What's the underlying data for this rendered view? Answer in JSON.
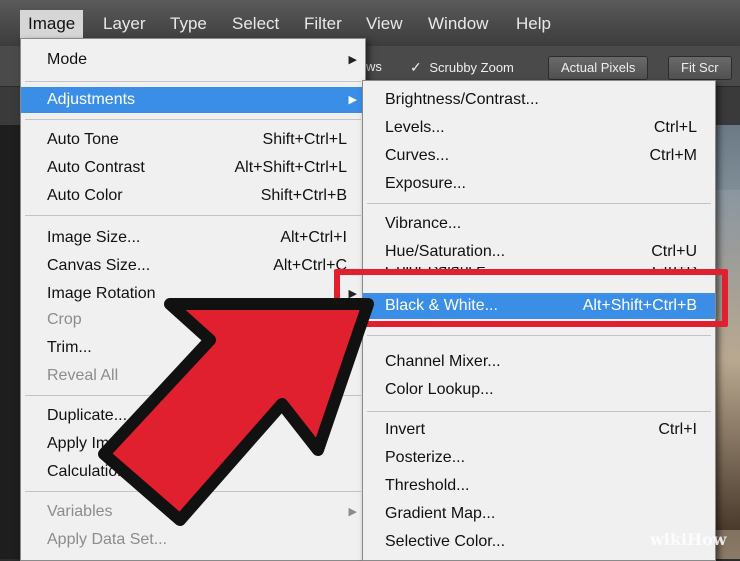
{
  "menubar": {
    "items": [
      "Image",
      "Layer",
      "Type",
      "Select",
      "Filter",
      "View",
      "Window",
      "Help"
    ]
  },
  "optionsbar": {
    "partial": "ws",
    "scrubby_zoom": "Scrubby Zoom",
    "actual_pixels": "Actual Pixels",
    "fit_screen": "Fit Scr"
  },
  "image_menu": {
    "mode": "Mode",
    "adjustments": "Adjustments",
    "auto_tone": {
      "label": "Auto Tone",
      "shortcut": "Shift+Ctrl+L"
    },
    "auto_contrast": {
      "label": "Auto Contrast",
      "shortcut": "Alt+Shift+Ctrl+L"
    },
    "auto_color": {
      "label": "Auto Color",
      "shortcut": "Shift+Ctrl+B"
    },
    "image_size": {
      "label": "Image Size...",
      "shortcut": "Alt+Ctrl+I"
    },
    "canvas_size": {
      "label": "Canvas Size...",
      "shortcut": "Alt+Ctrl+C"
    },
    "image_rotation": "Image Rotation",
    "crop": "Crop",
    "trim": "Trim...",
    "reveal_all": "Reveal All",
    "duplicate": "Duplicate...",
    "apply_image": "Apply Image...",
    "calculations": "Calculations...",
    "variables": "Variables",
    "apply_data_set": "Apply Data Set..."
  },
  "adjustments_menu": {
    "brightness_contrast": "Brightness/Contrast...",
    "levels": {
      "label": "Levels...",
      "shortcut": "Ctrl+L"
    },
    "curves": {
      "label": "Curves...",
      "shortcut": "Ctrl+M"
    },
    "exposure": "Exposure...",
    "vibrance": "Vibrance...",
    "hue_saturation": {
      "label": "Hue/Saturation...",
      "shortcut": "Ctrl+U"
    },
    "color_balance": {
      "label": "Color Balance...",
      "shortcut": "Ctrl+B"
    },
    "black_white": {
      "label": "Black & White...",
      "shortcut": "Alt+Shift+Ctrl+B"
    },
    "channel_mixer": "Channel Mixer...",
    "color_lookup": "Color Lookup...",
    "invert": {
      "label": "Invert",
      "shortcut": "Ctrl+I"
    },
    "posterize": "Posterize...",
    "threshold": "Threshold...",
    "gradient_map": "Gradient Map...",
    "selective_color": "Selective Color..."
  },
  "watermark": "wikiHow",
  "colors": {
    "highlight": "#3a8ee6",
    "annotation_red": "#e0202f"
  }
}
